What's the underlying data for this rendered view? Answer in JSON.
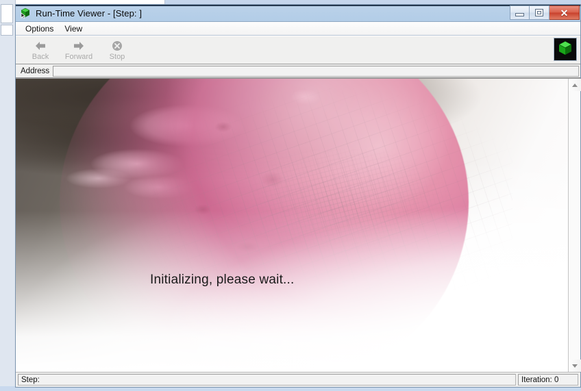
{
  "window": {
    "title": "Run-Time Viewer - [Step: ]",
    "app_icon": "green-cube-icon",
    "controls": {
      "minimize_label": "minimize-icon",
      "maximize_label": "maximize-icon",
      "close_label": "✕"
    }
  },
  "menu": {
    "items": [
      {
        "label": "Options"
      },
      {
        "label": "View"
      }
    ]
  },
  "toolbar": {
    "buttons": [
      {
        "label": "Back",
        "icon": "arrow-left-icon",
        "enabled": false
      },
      {
        "label": "Forward",
        "icon": "arrow-right-icon",
        "enabled": false
      },
      {
        "label": "Stop",
        "icon": "stop-circle-icon",
        "enabled": false
      }
    ],
    "logo": {
      "icon": "green-cube-logo-icon"
    }
  },
  "address": {
    "label": "Address",
    "value": "",
    "placeholder": ""
  },
  "content": {
    "loading_message": "Initializing, please wait...",
    "background_art": "pink-globe-artwork"
  },
  "scrollbar": {
    "up_arrow": "scroll-up-icon",
    "down_arrow": "scroll-down-icon"
  },
  "status_bar": {
    "step_label": "Step:",
    "iteration_label": "Iteration: 0"
  },
  "colors": {
    "title_bar": "#b6cfe8",
    "close_button": "#c8412c",
    "toolbar_bg": "#f0f0ef",
    "disabled_text": "#a9a9a9",
    "accent_green": "#1fa81f",
    "planet_pink": "#d9729a"
  }
}
